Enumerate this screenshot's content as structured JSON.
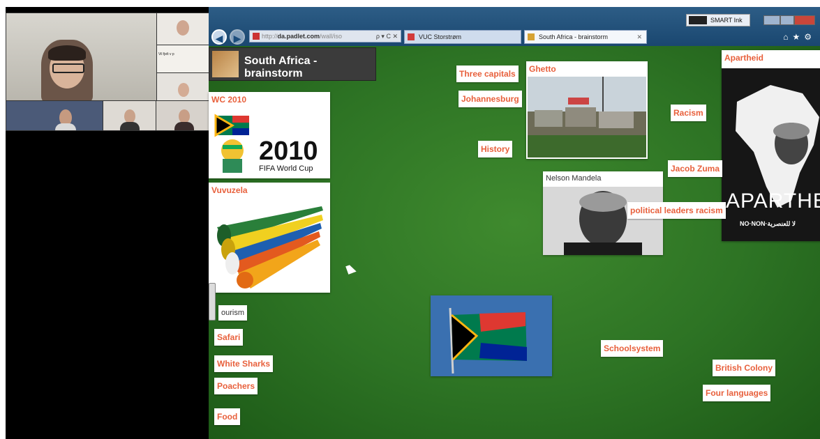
{
  "conference": {
    "main_label": "",
    "msg_tile": "Vil fjelt v p",
    "participants": [
      "",
      "",
      "",
      "",
      "",
      ""
    ]
  },
  "browser": {
    "address": {
      "prefix": "http://",
      "domain": "da.padlet.com",
      "path": "/wall/iso",
      "tools": "ρ ▾ C ✕"
    },
    "tabs": [
      {
        "label": "VUC Storstrøm",
        "favicon_color": "#d23b3b"
      },
      {
        "label": "South Africa - brainstorm",
        "favicon_color": "#d6a334",
        "close": "✕"
      }
    ],
    "smart_ink_label": "SMART Ink",
    "toolbar_icons": "⌂★⚙",
    "nav": {
      "back": "◀",
      "forward": "▶"
    }
  },
  "padlet": {
    "title": "South Africa - brainstorm",
    "cards": {
      "wc2010": {
        "header": "WC 2010",
        "big_year": "2010",
        "subtitle": "FIFA World Cup"
      },
      "vuvuzela": {
        "header": "Vuvuzela"
      },
      "ghetto": {
        "header": "Ghetto"
      },
      "mandela": {
        "header": "Nelson Mandela"
      },
      "apartheid": {
        "header": "Apartheid",
        "poster_word": "APARTHEI",
        "poster_slogan": "NO·NON·لا للعنصرية"
      }
    },
    "notes": {
      "three_capitals": "Three capitals",
      "johannesburg": "Johannesburg",
      "history": "History",
      "racism": "Racism",
      "jacob_zuma": "Jacob Zuma",
      "political_leaders": "political leaders racism",
      "tourism": "ourism",
      "safari": "Safari",
      "white_sharks": "White Sharks",
      "poachers": "Poachers",
      "food": "Food",
      "schoolsystem": "Schoolsystem",
      "british_colony": "British Colony",
      "four_languages": "Four languages"
    }
  },
  "colors": {
    "note_text": "#e8603c",
    "board": "#2d7324",
    "toolbar": "#1a4770"
  }
}
